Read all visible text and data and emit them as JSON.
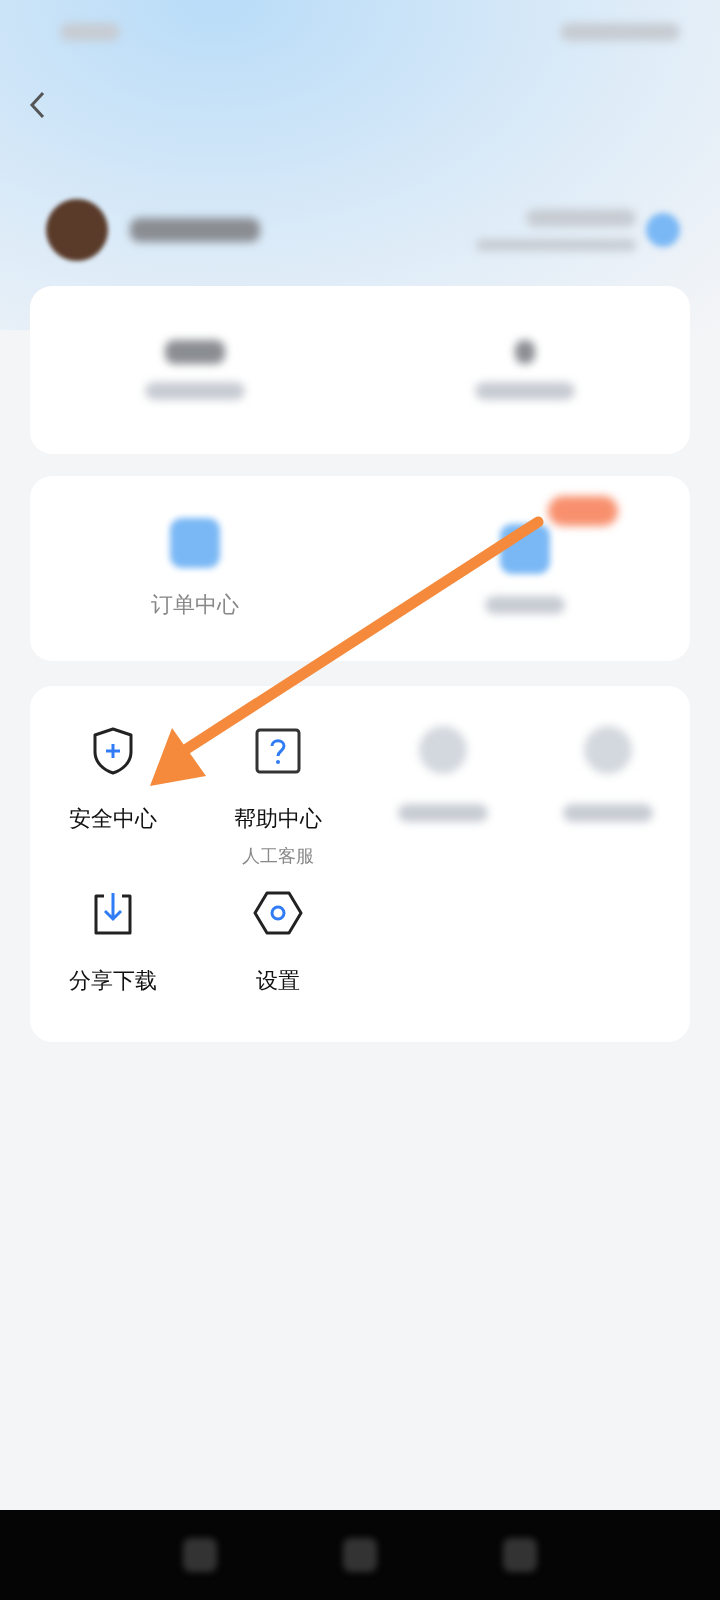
{
  "order_card": {
    "items": [
      {
        "kind": "order",
        "label": "订单中心"
      },
      {
        "kind": "blurred"
      }
    ]
  },
  "menu": {
    "items": [
      {
        "kind": "shield",
        "label": "安全中心"
      },
      {
        "kind": "help",
        "label": "帮助中心",
        "sublabel": "人工客服"
      },
      {
        "kind": "blurred"
      },
      {
        "kind": "blurred"
      },
      {
        "kind": "download",
        "label": "分享下载"
      },
      {
        "kind": "settings",
        "label": "设置"
      }
    ]
  }
}
